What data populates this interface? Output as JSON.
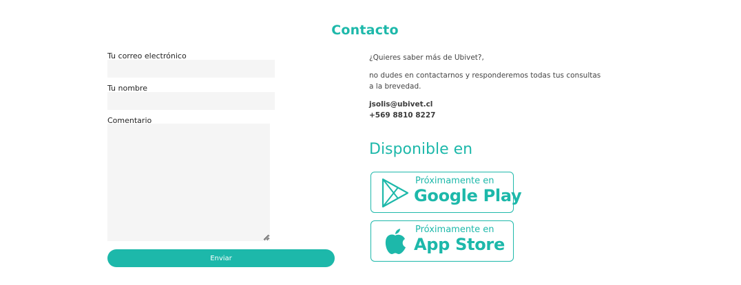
{
  "contact": {
    "title": "Contacto"
  },
  "form": {
    "email_label": "Tu correo electrónico",
    "email_value": "",
    "name_label": "Tu nombre",
    "name_value": "",
    "comment_label": "Comentario",
    "comment_value": "",
    "submit_label": "Enviar"
  },
  "info": {
    "question": "¿Quieres saber más de Ubivet?,",
    "message": "no dudes en contactarnos y responderemos todas tus  consultas a la brevedad.",
    "email": "jsolis@ubivet.cl",
    "phone": "+569 8810 8227"
  },
  "stores": {
    "title": "Disponible en",
    "google_play": {
      "subtitle": "Próximamente en",
      "name": "Google Play",
      "icon": "google-play-icon"
    },
    "app_store": {
      "subtitle": "Próximamente en",
      "name": "App Store",
      "icon": "apple-icon"
    }
  },
  "colors": {
    "accent": "#1db8aa",
    "input_background": "#f5f5f5",
    "button_text": "#ffffff"
  }
}
